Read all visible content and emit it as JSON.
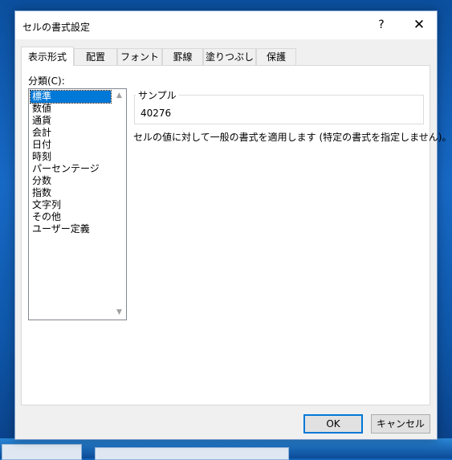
{
  "dialog": {
    "title": "セルの書式設定",
    "help_label": "?",
    "close_label": "✕"
  },
  "tabs": [
    {
      "label": "表示形式",
      "active": true
    },
    {
      "label": "配置"
    },
    {
      "label": "フォント"
    },
    {
      "label": "罫線"
    },
    {
      "label": "塗りつぶし"
    },
    {
      "label": "保護"
    }
  ],
  "category": {
    "label": "分類(C):",
    "items": [
      "標準",
      "数値",
      "通貨",
      "会計",
      "日付",
      "時刻",
      "パーセンテージ",
      "分数",
      "指数",
      "文字列",
      "その他",
      "ユーザー定義"
    ],
    "selected": "標準"
  },
  "sample": {
    "legend": "サンプル",
    "value": "40276"
  },
  "description": "セルの値に対して一般の書式を適用します (特定の書式を指定しません)。",
  "buttons": {
    "ok": "OK",
    "cancel": "キャンセル"
  },
  "icons": {
    "scroll_up": "▲",
    "scroll_down": "▼"
  }
}
